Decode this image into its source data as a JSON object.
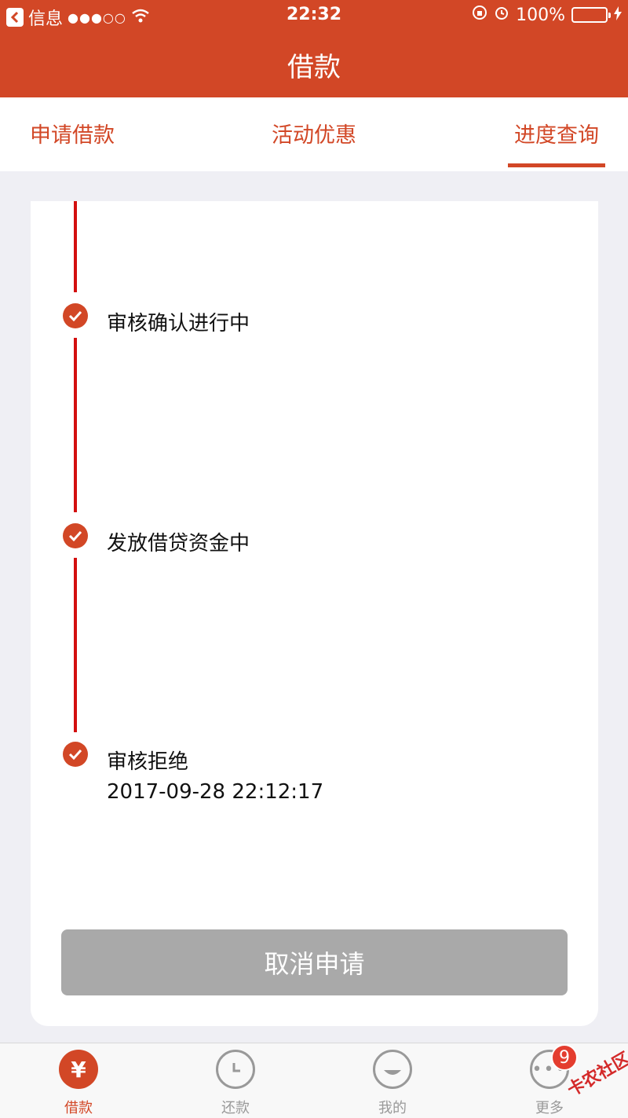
{
  "status_bar": {
    "back_app": "信息",
    "time": "22:32",
    "battery": "100%"
  },
  "nav": {
    "title": "借款"
  },
  "tabs": [
    {
      "label": "申请借款"
    },
    {
      "label": "活动优惠"
    },
    {
      "label": "进度查询",
      "active": true
    }
  ],
  "timeline": [
    {
      "label": "审核确认进行中",
      "time": ""
    },
    {
      "label": "发放借贷资金中",
      "time": ""
    },
    {
      "label": "审核拒绝",
      "time": "2017-09-28 22:12:17"
    }
  ],
  "cancel_button": {
    "label": "取消申请"
  },
  "bottom_tabs": [
    {
      "label": "借款",
      "icon": "yen-icon",
      "active": true
    },
    {
      "label": "还款",
      "icon": "clock-icon"
    },
    {
      "label": "我的",
      "icon": "smile-icon"
    },
    {
      "label": "更多",
      "icon": "more-icon",
      "badge": "9"
    }
  ],
  "watermark": "卡农社区",
  "colors": {
    "accent": "#d24726",
    "timeline": "#d30f0f",
    "disabled_button": "#a9a9a9"
  }
}
